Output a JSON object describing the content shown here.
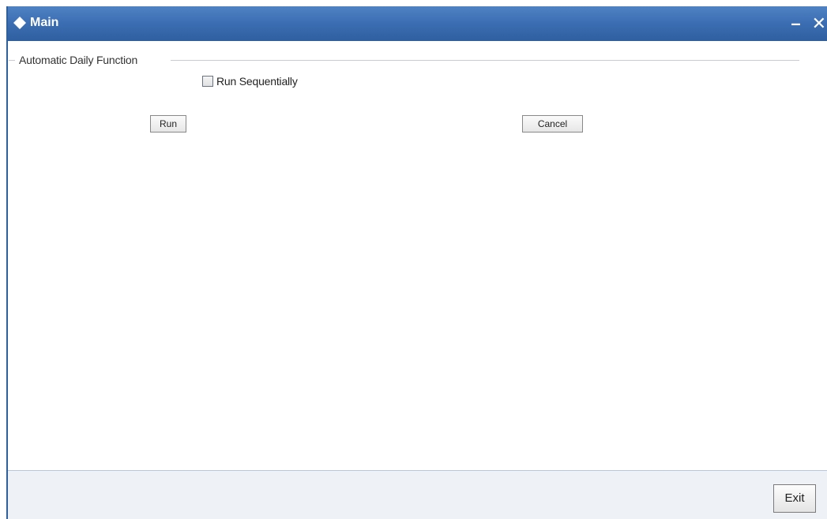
{
  "window": {
    "title": "Main",
    "minimize_glyph": "–",
    "close_glyph": "✕"
  },
  "fieldset": {
    "legend": "Automatic Daily Function",
    "run_sequentially_label": "Run Sequentially",
    "run_sequentially_checked": false
  },
  "buttons": {
    "run_label": "Run",
    "cancel_label": "Cancel"
  },
  "footer": {
    "exit_label": "Exit"
  },
  "icons": {
    "title_icon": "diamond-icon"
  },
  "colors": {
    "titlebar": "#3a6db2",
    "footer_bg": "#eef1f6"
  }
}
